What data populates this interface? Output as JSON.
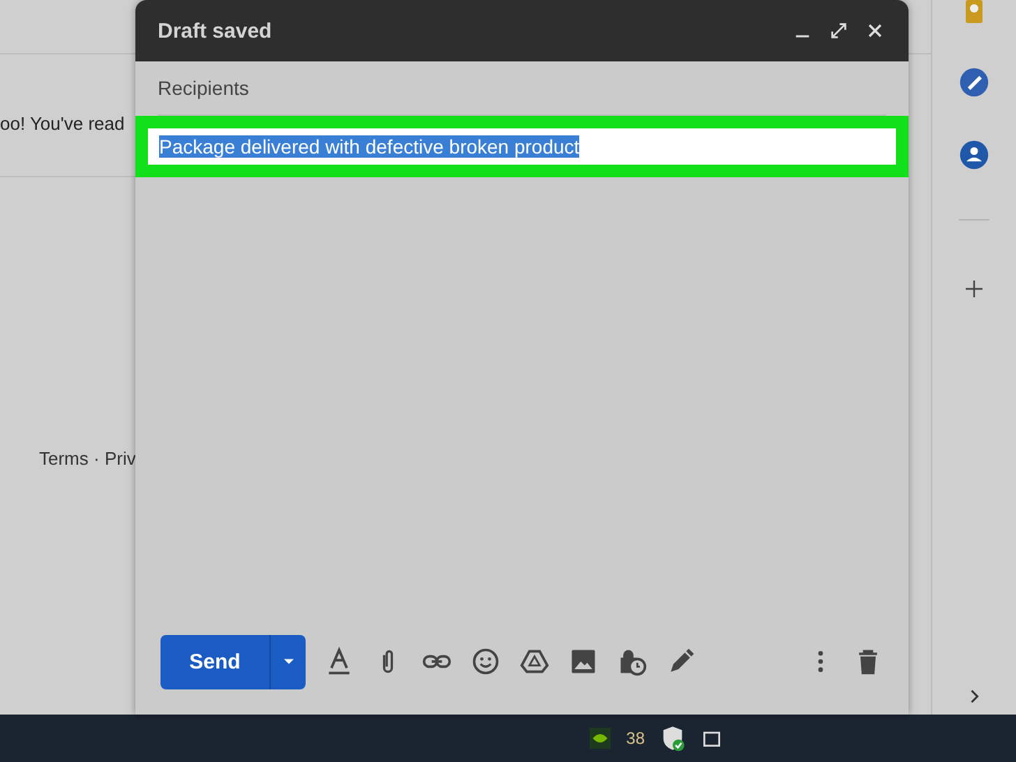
{
  "background": {
    "snippet": "oo! You've read",
    "footer": "Terms · Priv"
  },
  "compose": {
    "title": "Draft saved",
    "recipients": "Recipients",
    "subject": "Package delivered with defective broken product",
    "subject_selected": true,
    "send": "Send"
  },
  "taskbar": {
    "temperature": "38"
  }
}
